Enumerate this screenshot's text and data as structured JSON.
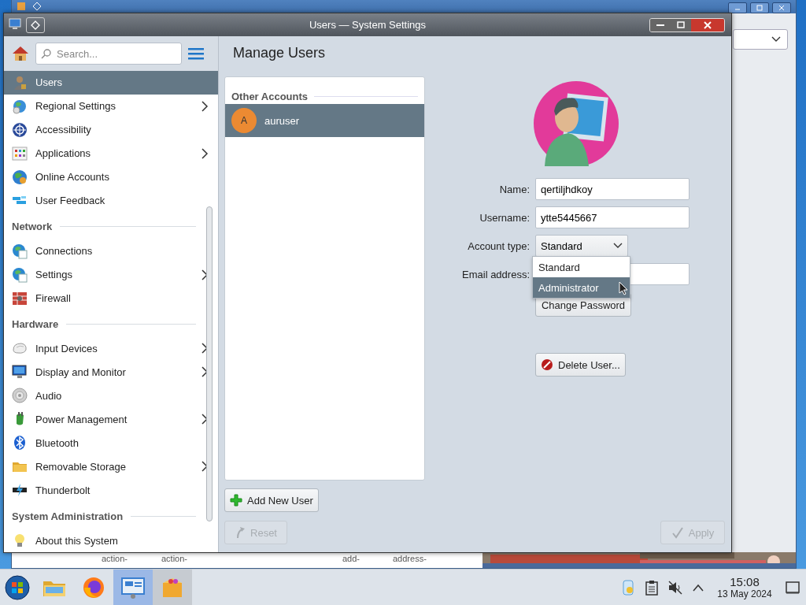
{
  "background_window": {
    "fragments": [
      "action-",
      "action-",
      "add-",
      "address-"
    ]
  },
  "window": {
    "title": "Users — System Settings"
  },
  "sidebar": {
    "search": {
      "placeholder": "Search..."
    },
    "items": [
      {
        "kind": "item",
        "label": "Users",
        "selected": true,
        "submenu": false
      },
      {
        "kind": "item",
        "label": "Regional Settings",
        "selected": false,
        "submenu": true
      },
      {
        "kind": "item",
        "label": "Accessibility",
        "selected": false,
        "submenu": false
      },
      {
        "kind": "item",
        "label": "Applications",
        "selected": false,
        "submenu": true
      },
      {
        "kind": "item",
        "label": "Online Accounts",
        "selected": false,
        "submenu": false
      },
      {
        "kind": "item",
        "label": "User Feedback",
        "selected": false,
        "submenu": false
      },
      {
        "kind": "header",
        "label": "Network"
      },
      {
        "kind": "item",
        "label": "Connections",
        "selected": false,
        "submenu": false
      },
      {
        "kind": "item",
        "label": "Settings",
        "selected": false,
        "submenu": true
      },
      {
        "kind": "item",
        "label": "Firewall",
        "selected": false,
        "submenu": false
      },
      {
        "kind": "header",
        "label": "Hardware"
      },
      {
        "kind": "item",
        "label": "Input Devices",
        "selected": false,
        "submenu": true
      },
      {
        "kind": "item",
        "label": "Display and Monitor",
        "selected": false,
        "submenu": true
      },
      {
        "kind": "item",
        "label": "Audio",
        "selected": false,
        "submenu": false
      },
      {
        "kind": "item",
        "label": "Power Management",
        "selected": false,
        "submenu": true
      },
      {
        "kind": "item",
        "label": "Bluetooth",
        "selected": false,
        "submenu": false
      },
      {
        "kind": "item",
        "label": "Removable Storage",
        "selected": false,
        "submenu": true
      },
      {
        "kind": "item",
        "label": "Thunderbolt",
        "selected": false,
        "submenu": false
      },
      {
        "kind": "header",
        "label": "System Administration"
      },
      {
        "kind": "item",
        "label": "About this System",
        "selected": false,
        "submenu": false
      }
    ]
  },
  "page": {
    "title": "Manage Users"
  },
  "accounts": {
    "heading": "Other Accounts",
    "users": [
      {
        "initial": "A",
        "name": "auruser",
        "selected": true
      }
    ],
    "add_button": "Add New User"
  },
  "form": {
    "fields": [
      {
        "kind": "text",
        "label": "Name:",
        "value": "qertiljhdkoy"
      },
      {
        "kind": "text",
        "label": "Username:",
        "value": "ytte5445667"
      },
      {
        "kind": "select",
        "label": "Account type:",
        "value": "Standard"
      },
      {
        "kind": "text",
        "label": "Email address:"
      }
    ],
    "account_type_options": [
      {
        "label": "Standard",
        "highlighted": false
      },
      {
        "label": "Administrator",
        "highlighted": true
      }
    ],
    "change_password": "Change Password",
    "delete_button": "Delete User..."
  },
  "footer": {
    "reset": {
      "label": "Reset",
      "disabled": true
    },
    "apply": {
      "label": "Apply",
      "disabled": true
    }
  },
  "taskbar": {
    "apps": [
      {
        "active": false
      },
      {
        "active": false
      },
      {
        "active": true
      },
      {
        "active": false,
        "hovered": true
      }
    ],
    "clock": {
      "time": "15:08",
      "date": "13 May 2024"
    }
  }
}
